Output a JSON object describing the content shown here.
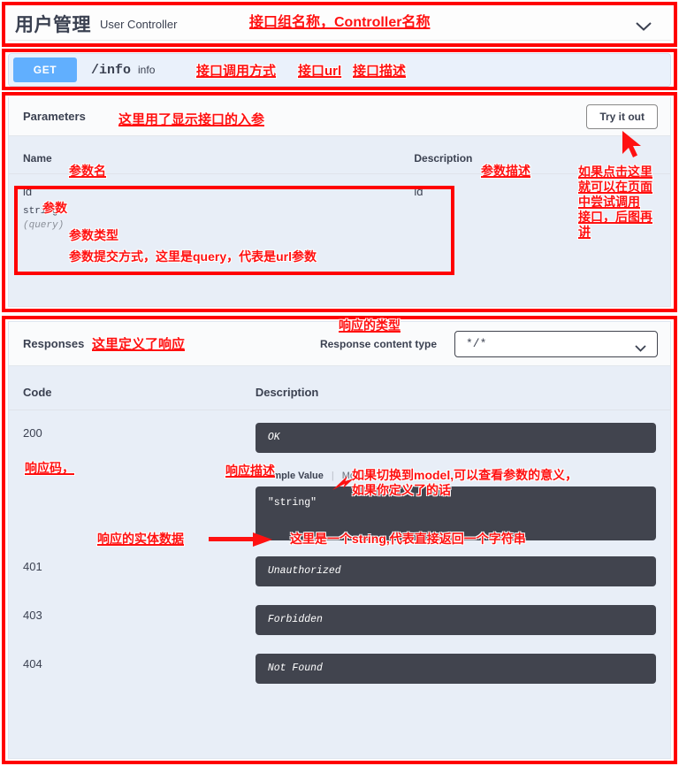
{
  "tag": {
    "title": "用户管理",
    "subtitle": "User Controller",
    "collapse_icon": "chevron-down-icon"
  },
  "operation": {
    "method": "GET",
    "path": "/info",
    "summary": "info"
  },
  "parameters": {
    "section_title": "Parameters",
    "try_it_out_label": "Try it out",
    "columns": [
      "Name",
      "Description"
    ],
    "rows": [
      {
        "name": "id",
        "type": "string",
        "in": "(query)",
        "description": "id"
      }
    ]
  },
  "responses": {
    "section_title": "Responses",
    "content_type_label": "Response content type",
    "content_type_value": "*/*",
    "caret_icon": "chevron-down-icon",
    "columns": [
      "Code",
      "Description"
    ],
    "example_tabs": {
      "example_value": "Example Value",
      "model": "Model"
    },
    "example_code": "\"string\"",
    "rows": [
      {
        "code": "200",
        "description": "OK",
        "has_example": true
      },
      {
        "code": "401",
        "description": "Unauthorized",
        "has_example": false
      },
      {
        "code": "403",
        "description": "Forbidden",
        "has_example": false
      },
      {
        "code": "404",
        "description": "Not Found",
        "has_example": false
      }
    ]
  },
  "annotations": {
    "tag_name": "接口组名称，Controller名称",
    "method_label": "接口调用方式",
    "url_label": "接口url",
    "summary_label": "接口描述",
    "parameters_note": "这里用了显示接口的入参",
    "param_name_label": "参数名",
    "param_desc_label": "参数描述",
    "param_value_label": "参数",
    "param_type_label": "参数类型",
    "param_in_label": "参数提交方式，这里是query，代表是url参数",
    "try_it_out_note": "如果点击这里\n就可以在页面\n中尝试调用\n接口，后图再\n讲",
    "responses_note": "这里定义了响应",
    "content_type_note": "响应的类型",
    "response_code_note": "响应码，",
    "response_desc_note": "响应描述",
    "model_note": "如果切换到model,可以查看参数的意义，\n如果你定义了的话",
    "entity_note": "响应的实体数据",
    "string_note": "这里是一个string,代表直接返回一个字符串"
  },
  "colors": {
    "annotation_red": "#ff1111",
    "get_blue": "#61affe",
    "panel_bg": "#e8eef7",
    "code_block_bg": "#41444e"
  }
}
